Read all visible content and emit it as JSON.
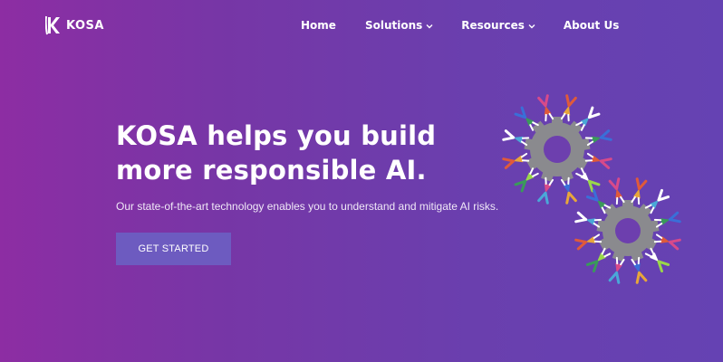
{
  "brand": {
    "name": "KOSA",
    "logo_icon": "kosa-logo-icon"
  },
  "nav": {
    "items": [
      {
        "label": "Home",
        "has_dropdown": false
      },
      {
        "label": "Solutions",
        "has_dropdown": true
      },
      {
        "label": "Resources",
        "has_dropdown": true
      },
      {
        "label": "About Us",
        "has_dropdown": false
      }
    ]
  },
  "hero": {
    "headline_line1": "KOSA helps you build",
    "headline_line2": "more responsible AI.",
    "subtext": "Our state-of-the-art technology enables you to understand and mitigate AI risks.",
    "cta_label": "GET STARTED",
    "illustration_icon": "gears-with-people-illustration"
  },
  "colors": {
    "gradient_start": "#8d2da3",
    "gradient_end": "#6542b3",
    "cta_background": "#6d5bc0",
    "gear": "#8a8a8e"
  }
}
